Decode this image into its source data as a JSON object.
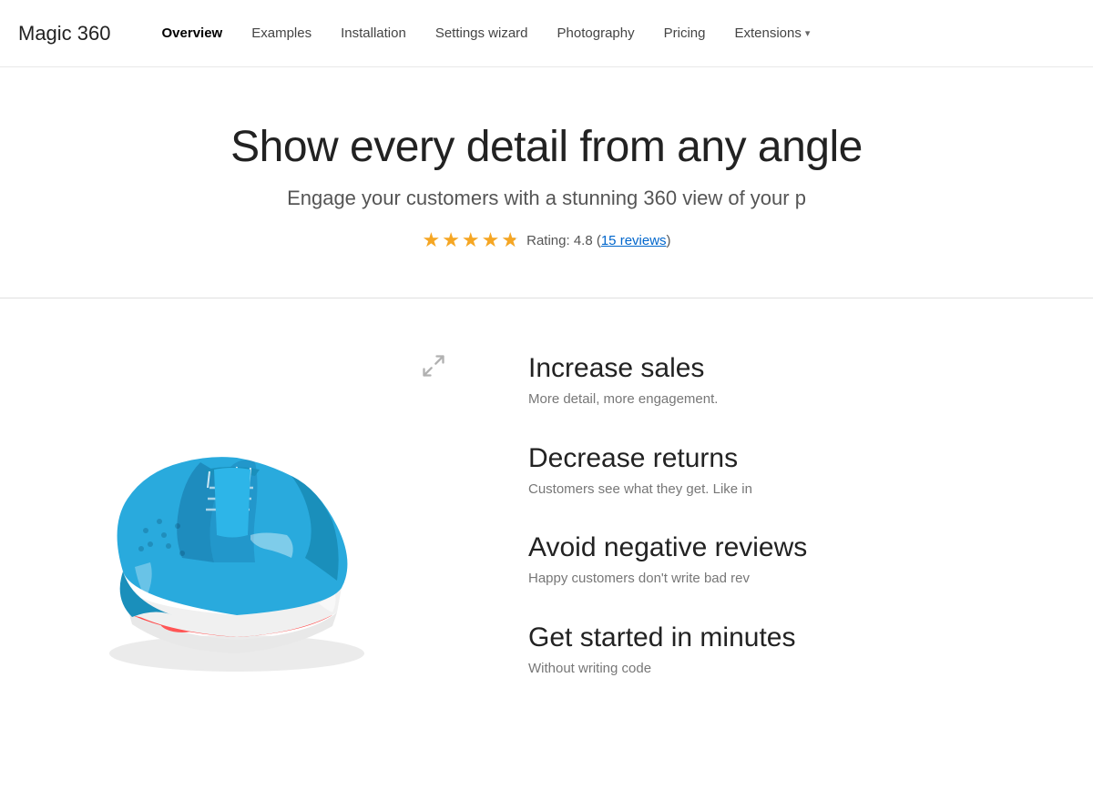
{
  "header": {
    "logo": "Magic 360",
    "nav": [
      {
        "id": "overview",
        "label": "Overview",
        "active": true,
        "hasDropdown": false
      },
      {
        "id": "examples",
        "label": "Examples",
        "active": false,
        "hasDropdown": false
      },
      {
        "id": "installation",
        "label": "Installation",
        "active": false,
        "hasDropdown": false
      },
      {
        "id": "settings-wizard",
        "label": "Settings wizard",
        "active": false,
        "hasDropdown": false
      },
      {
        "id": "photography",
        "label": "Photography",
        "active": false,
        "hasDropdown": false
      },
      {
        "id": "pricing",
        "label": "Pricing",
        "active": false,
        "hasDropdown": false
      },
      {
        "id": "extensions",
        "label": "Extensions",
        "active": false,
        "hasDropdown": true
      }
    ]
  },
  "hero": {
    "title": "Show every detail from any angle",
    "subtitle": "Engage your customers with a stunning 360 view of your p",
    "rating": {
      "value": "4.8",
      "label": "Rating: 4.8",
      "reviews_text": "15 reviews",
      "reviews_count": 15
    }
  },
  "features": [
    {
      "id": "increase-sales",
      "title": "Increase sales",
      "description": "More detail, more engagement."
    },
    {
      "id": "decrease-returns",
      "title": "Decrease returns",
      "description": "Customers see what they get. Like in"
    },
    {
      "id": "avoid-negative-reviews",
      "title": "Avoid negative reviews",
      "description": "Happy customers don't write bad rev"
    },
    {
      "id": "get-started",
      "title": "Get started in minutes",
      "description": "Without writing code"
    }
  ]
}
